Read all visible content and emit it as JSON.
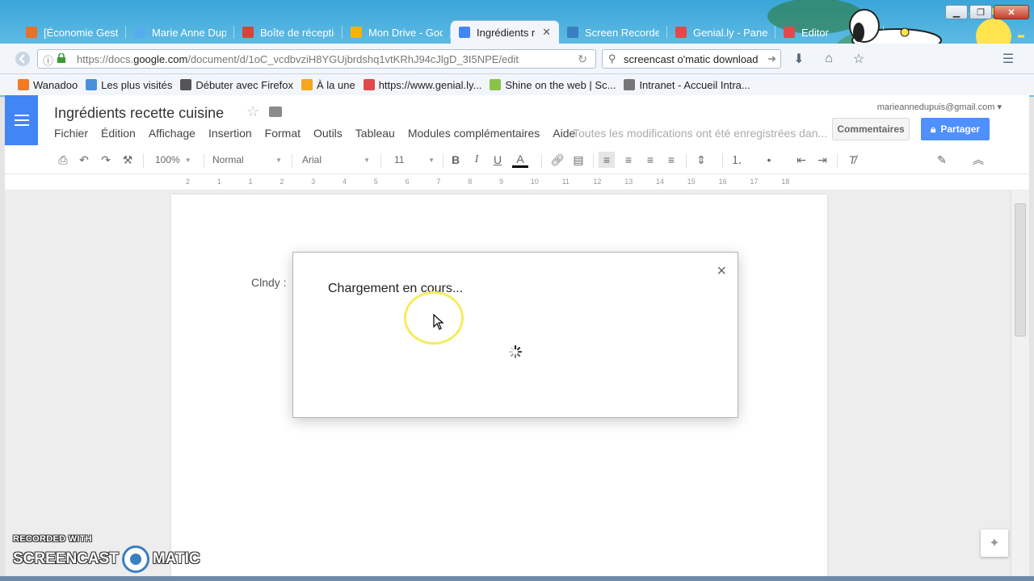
{
  "browser": {
    "tabs": [
      {
        "label": "[Économie Gestic",
        "icon": "orange-square-icon",
        "color": "#e8702a"
      },
      {
        "label": "Marie Anne Dup",
        "icon": "twitter-bird-icon",
        "color": "#55acee"
      },
      {
        "label": "Boîte de réceptio",
        "icon": "gmail-envelope-icon",
        "color": "#d14836"
      },
      {
        "label": "Mon Drive - Goo",
        "icon": "google-drive-icon",
        "color": "#f4b400"
      },
      {
        "label": "Ingrédients re",
        "icon": "google-docs-icon",
        "color": "#4285f4",
        "active": true
      },
      {
        "label": "Screen Recorder",
        "icon": "screencast-circle-icon",
        "color": "#3a7fc1"
      },
      {
        "label": "Genial.ly - Panel",
        "icon": "genially-icon",
        "color": "#e04a4a"
      },
      {
        "label": "Editor",
        "icon": "genially-icon",
        "color": "#e04a4a"
      }
    ],
    "url_prefix": "https://docs.",
    "url_domain": "google.com",
    "url_rest": "/document/d/1oC_vcdbvziH8YGUjbrdshq1vtKRhJ94cJlgD_3I5NPE/edit",
    "search_value": "screencast o'matic download",
    "bookmarks": [
      {
        "label": "Wanadoo",
        "color": "#f47a20"
      },
      {
        "label": "Les plus visités",
        "color": "#4a90d9"
      },
      {
        "label": "Débuter avec Firefox",
        "color": "#555555"
      },
      {
        "label": "À la une",
        "color": "#f5a623"
      },
      {
        "label": "https://www.genial.ly...",
        "color": "#e04a4a"
      },
      {
        "label": "Shine on the web | Sc...",
        "color": "#8bc34a"
      },
      {
        "label": "Intranet - Accueil Intra...",
        "color": "#777777"
      }
    ]
  },
  "docs": {
    "title": "Ingrédients recette cuisine",
    "account": "marieannedupuis@gmail.com",
    "menus": [
      "Fichier",
      "Édition",
      "Affichage",
      "Insertion",
      "Format",
      "Outils",
      "Tableau",
      "Modules complémentaires",
      "Aide"
    ],
    "save_status": "Toutes les modifications ont été enregistrées dan...",
    "comments_label": "Commentaires",
    "share_label": "Partager",
    "toolbar": {
      "zoom": "100%",
      "style": "Normal",
      "font": "Arial",
      "size": "11"
    },
    "ruler_numbers": [
      "2",
      "1",
      "1",
      "2",
      "3",
      "4",
      "5",
      "6",
      "7",
      "8",
      "9",
      "10",
      "11",
      "12",
      "13",
      "14",
      "15",
      "16",
      "17",
      "18"
    ],
    "body_text": "Clndy :"
  },
  "dialog": {
    "title": "Chargement en cours..."
  },
  "watermark": {
    "top": "RECORDED WITH",
    "left": "SCREENCAST",
    "right": "MATIC"
  },
  "colors": {
    "docs_blue": "#4285f4",
    "share_blue": "#4d90fe",
    "cursor_highlight": "#f5ec5c"
  }
}
